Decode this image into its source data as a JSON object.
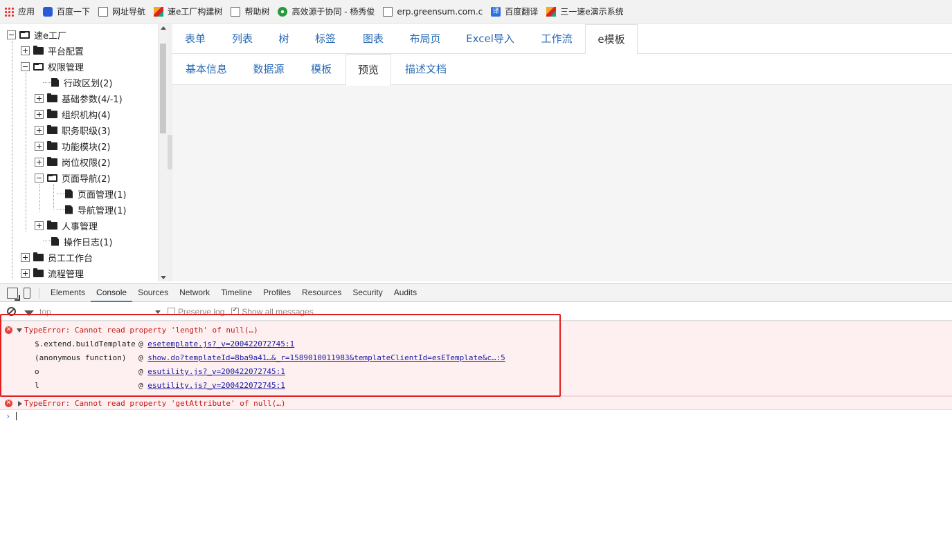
{
  "bookmarks": [
    {
      "icon": "apps-icon",
      "label": "应用"
    },
    {
      "icon": "baidu-paw-icon",
      "label": "百度一下"
    },
    {
      "icon": "page-icon",
      "label": "网址导航"
    },
    {
      "icon": "sujie-logo-icon",
      "label": "速e工厂构建树"
    },
    {
      "icon": "page-icon",
      "label": "帮助树"
    },
    {
      "icon": "gear-green-icon",
      "label": "高效源于协同 - 杨秀俊"
    },
    {
      "icon": "page-icon",
      "label": "erp.greensum.com.c"
    },
    {
      "icon": "translate-icon",
      "label": "百度翻译"
    },
    {
      "icon": "sujie-logo-icon",
      "label": "三一速e演示系统"
    }
  ],
  "tree": {
    "root": "速e工厂",
    "n1": "平台配置",
    "n2": "权限管理",
    "n3": "行政区划(2)",
    "n4": "基础参数(4/-1)",
    "n5": "组织机构(4)",
    "n6": "职务职级(3)",
    "n7": "功能模块(2)",
    "n8": "岗位权限(2)",
    "n9": "页面导航(2)",
    "n10": "页面管理(1)",
    "n11": "导航管理(1)",
    "n12": "人事管理",
    "n13": "操作日志(1)",
    "n14": "员工工作台",
    "n15": "流程管理"
  },
  "tabs1": {
    "t1": "表单",
    "t2": "列表",
    "t3": "树",
    "t4": "标签",
    "t5": "图表",
    "t6": "布局页",
    "t7": "Excel导入",
    "t8": "工作流",
    "t9": "e模板"
  },
  "tabs2": {
    "t1": "基本信息",
    "t2": "数据源",
    "t3": "模板",
    "t4": "预览",
    "t5": "描述文档"
  },
  "devtools": {
    "tabs": {
      "t1": "Elements",
      "t2": "Console",
      "t3": "Sources",
      "t4": "Network",
      "t5": "Timeline",
      "t6": "Profiles",
      "t7": "Resources",
      "t8": "Security",
      "t9": "Audits"
    },
    "context": "top",
    "preserve_log": "Preserve log",
    "show_all": "Show all messages"
  },
  "console": {
    "error1": "TypeError: Cannot read property 'length' of null(…)",
    "stack": {
      "f1": "$.extend.buildTemplate",
      "l1": "esetemplate.js?_v=200422072745:1",
      "f2": "(anonymous function)",
      "l2": "show.do?templateId=8ba9a41…&_r=1589010011983&templateClientId=esETemplate&c…:5",
      "f3": "o",
      "l3": "esutility.js?_v=200422072745:1",
      "f4": "l",
      "l4": "esutility.js?_v=200422072745:1"
    },
    "at": "@",
    "error2": "TypeError: Cannot read property 'getAttribute' of null(…)",
    "prompt": "›"
  }
}
